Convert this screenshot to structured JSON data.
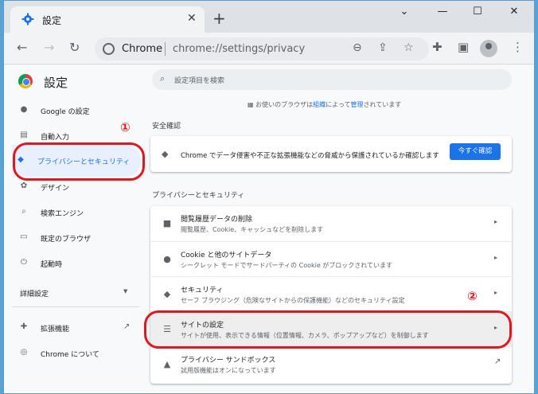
{
  "tab": {
    "title": "設定",
    "close": "✕",
    "new_tab": "+"
  },
  "window_controls": {
    "chevron": "⌄",
    "minimize": "—",
    "maximize": "☐",
    "close": "✕"
  },
  "toolbar": {
    "back": "←",
    "forward": "→",
    "reload": "↻",
    "site_label": "Chrome",
    "url": "chrome://settings/privacy"
  },
  "settings": {
    "title": "設定",
    "search_placeholder": "設定項目を検索",
    "nav": [
      {
        "label": "Google の設定",
        "icon": "person-icon"
      },
      {
        "label": "自動入力",
        "icon": "clipboard-icon"
      },
      {
        "label": "プライバシーとセキュリティ",
        "icon": "shield-icon"
      },
      {
        "label": "デザイン",
        "icon": "palette-icon"
      },
      {
        "label": "検索エンジン",
        "icon": "search-icon"
      },
      {
        "label": "既定のブラウザ",
        "icon": "browser-icon"
      },
      {
        "label": "起動時",
        "icon": "power-icon"
      }
    ],
    "advanced": "詳細設定",
    "extensions": "拡張機能",
    "about": "Chrome について"
  },
  "main": {
    "managed_prefix": "お使いのブラウザは",
    "managed_link1": "組織",
    "managed_mid": "によって",
    "managed_link2": "管理",
    "managed_suffix": "されています",
    "safety_heading": "安全確認",
    "safety_text": "Chrome でデータ侵害や不正な拡張機能などの脅威から保護されているか確認します",
    "safety_button": "今すぐ確認",
    "privacy_heading": "プライバシーとセキュリティ",
    "rows": [
      {
        "title": "閲覧履歴データの削除",
        "subtitle": "閲覧履歴、Cookie、キャッシュなどを削除します",
        "icon": "trash-icon"
      },
      {
        "title": "Cookie と他のサイトデータ",
        "subtitle": "シークレット モードでサードパーティの Cookie がブロックされています",
        "icon": "cookie-icon"
      },
      {
        "title": "セキュリティ",
        "subtitle": "セーフ ブラウジング（危険なサイトからの保護機能）などのセキュリティ設定",
        "icon": "shield-icon"
      },
      {
        "title": "サイトの設定",
        "subtitle": "サイトが使用、表示できる情報（位置情報、カメラ、ポップアップなど）を制御します",
        "icon": "tune-icon"
      },
      {
        "title": "プライバシー サンドボックス",
        "subtitle": "試用版機能はオンになっています",
        "icon": "flask-icon"
      }
    ]
  },
  "annotations": {
    "mark1": "①",
    "mark2": "②"
  },
  "colors": {
    "accent": "#1a73e8",
    "annotation": "#e0171e"
  }
}
